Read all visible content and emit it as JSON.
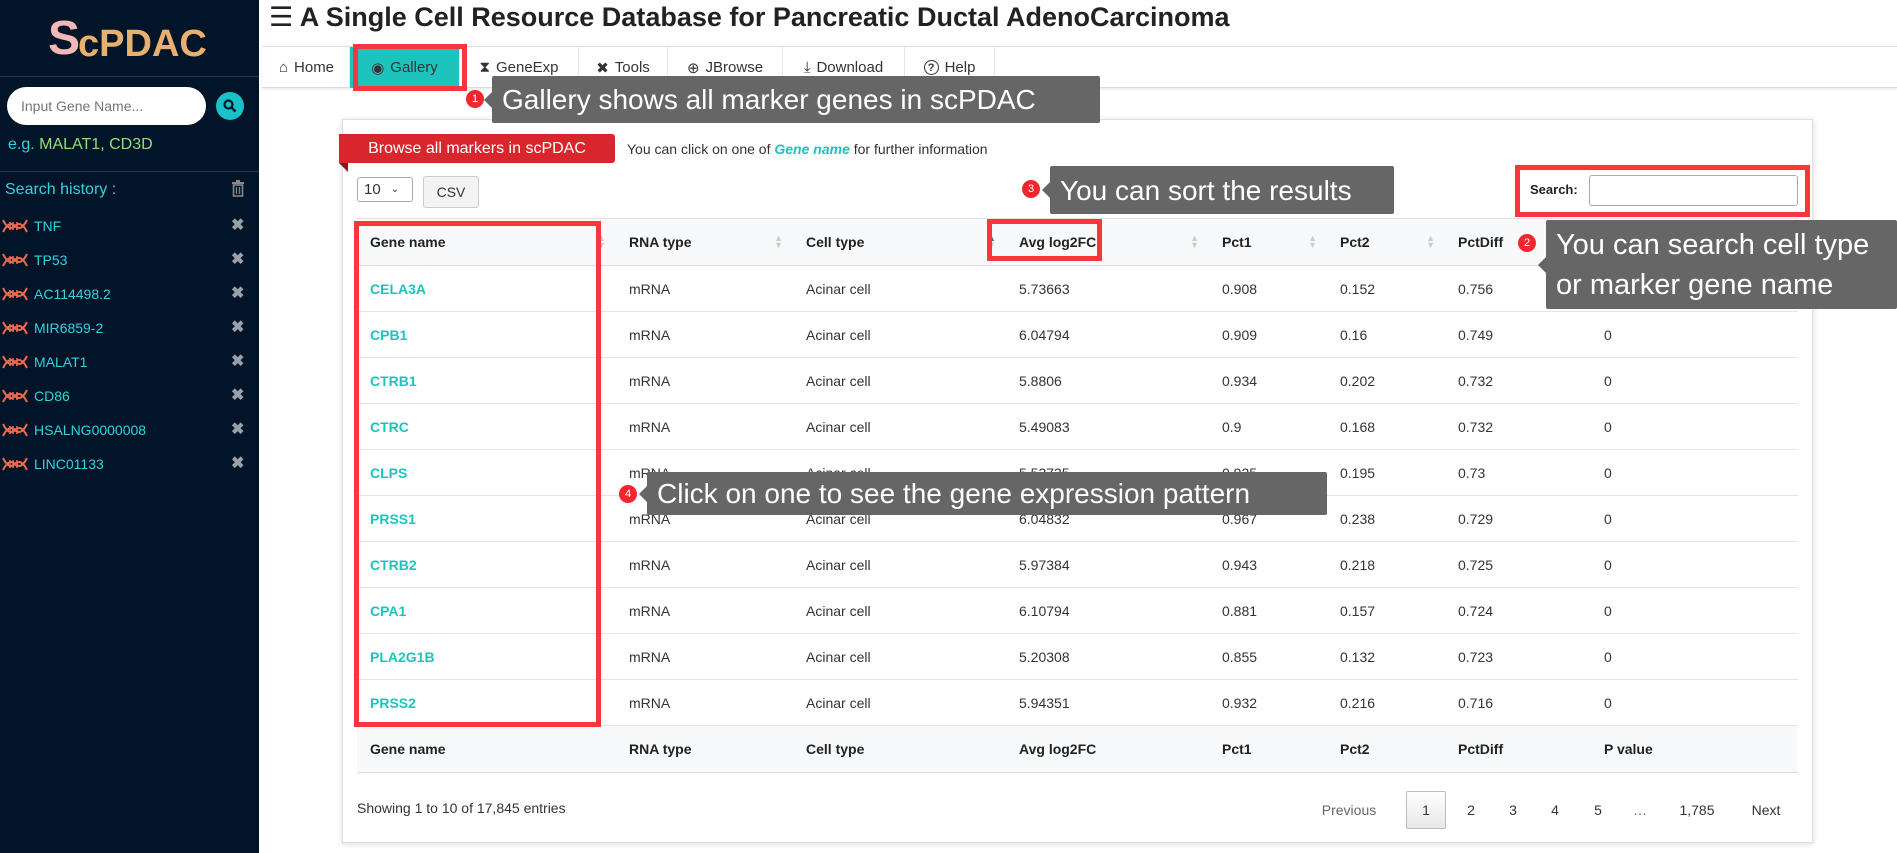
{
  "sidebar": {
    "logo": "scPDAC",
    "search_placeholder": "Input Gene Name...",
    "example_prefix": "e.g.",
    "example_genes": "MALAT1, CD3D",
    "history_label": "Search history :",
    "history": [
      "TNF",
      "TP53",
      "AC114498.2",
      "MIR6859-2",
      "MALAT1",
      "CD86",
      "HSALNG0000008",
      "LINC01133"
    ]
  },
  "header": {
    "title": "A Single Cell Resource Database for Pancreatic Ductal AdenoCarcinoma"
  },
  "nav": [
    {
      "label": "Home",
      "icon": "home-icon"
    },
    {
      "label": "Gallery",
      "icon": "eye-icon",
      "active": true
    },
    {
      "label": "GeneExp",
      "icon": "hourglass-icon"
    },
    {
      "label": "Tools",
      "icon": "tools-icon"
    },
    {
      "label": "JBrowse",
      "icon": "globe-icon"
    },
    {
      "label": "Download",
      "icon": "download-icon"
    },
    {
      "label": "Help",
      "icon": "help-icon"
    }
  ],
  "panel": {
    "ribbon": "Browse all markers in scPDAC",
    "hint_before": "You can click on one of ",
    "hint_em": "Gene name",
    "hint_after": " for further information",
    "page_length": "10",
    "csv_label": "CSV",
    "search_label": "Search:",
    "search_value": ""
  },
  "table": {
    "columns": [
      "Gene name",
      "RNA type",
      "Cell type",
      "Avg log2FC",
      "Pct1",
      "Pct2",
      "PctDiff",
      "P value"
    ],
    "rows": [
      [
        "CELA3A",
        "mRNA",
        "Acinar cell",
        "5.73663",
        "0.908",
        "0.152",
        "0.756",
        "0"
      ],
      [
        "CPB1",
        "mRNA",
        "Acinar cell",
        "6.04794",
        "0.909",
        "0.16",
        "0.749",
        "0"
      ],
      [
        "CTRB1",
        "mRNA",
        "Acinar cell",
        "5.8806",
        "0.934",
        "0.202",
        "0.732",
        "0"
      ],
      [
        "CTRC",
        "mRNA",
        "Acinar cell",
        "5.49083",
        "0.9",
        "0.168",
        "0.732",
        "0"
      ],
      [
        "CLPS",
        "mRNA",
        "Acinar cell",
        "5.53735",
        "0.925",
        "0.195",
        "0.73",
        "0"
      ],
      [
        "PRSS1",
        "mRNA",
        "Acinar cell",
        "6.04832",
        "0.967",
        "0.238",
        "0.729",
        "0"
      ],
      [
        "CTRB2",
        "mRNA",
        "Acinar cell",
        "5.97384",
        "0.943",
        "0.218",
        "0.725",
        "0"
      ],
      [
        "CPA1",
        "mRNA",
        "Acinar cell",
        "6.10794",
        "0.881",
        "0.157",
        "0.724",
        "0"
      ],
      [
        "PLA2G1B",
        "mRNA",
        "Acinar cell",
        "5.20308",
        "0.855",
        "0.132",
        "0.723",
        "0"
      ],
      [
        "PRSS2",
        "mRNA",
        "Acinar cell",
        "5.94351",
        "0.932",
        "0.216",
        "0.716",
        "0"
      ]
    ],
    "sorted_column": "Cell type"
  },
  "footer": {
    "info": "Showing 1 to 10 of 17,845 entries",
    "pagination": [
      "Previous",
      "1",
      "2",
      "3",
      "4",
      "5",
      "…",
      "1,785",
      "Next"
    ],
    "current_page": "1"
  },
  "annotations": [
    {
      "num": "1",
      "text": "Gallery shows all marker genes in scPDAC"
    },
    {
      "num": "2",
      "text": "You can search cell type or marker gene name"
    },
    {
      "num": "3",
      "text": "You can sort the results"
    },
    {
      "num": "4",
      "text": "Click on one to see the gene expression pattern"
    }
  ],
  "colors": {
    "sidebar_bg": "#011428",
    "accent": "#1dc4be",
    "highlight": "#fa353b",
    "ribbon": "#d9262c",
    "annotation_bg": "#666666"
  }
}
